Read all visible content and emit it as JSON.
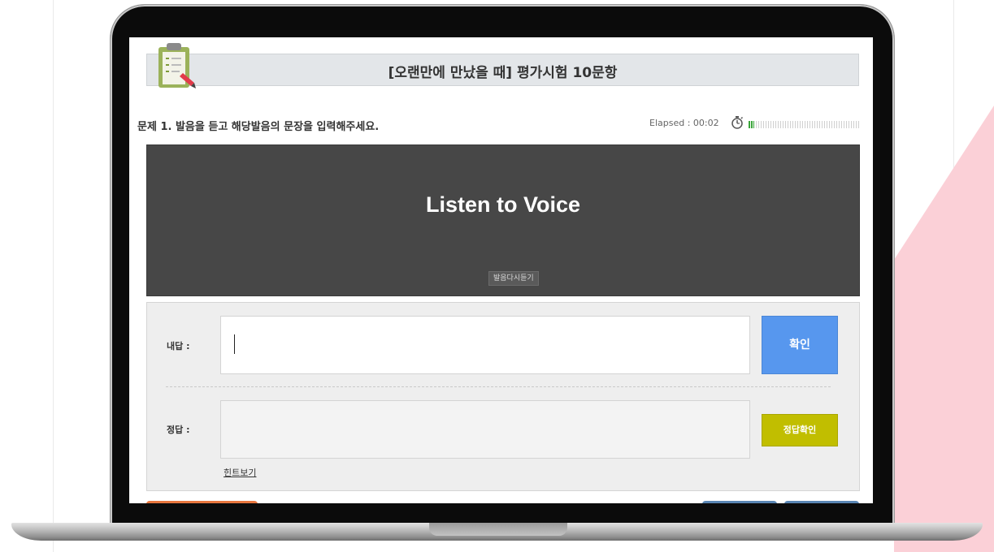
{
  "quiz": {
    "title": "[오랜만에 만났을 때] 평가시험 10문항",
    "icon": "clipboard-pencil-icon"
  },
  "question": {
    "text": "문제 1. 발음을 듣고 해당발음의 문장을 입력해주세요.",
    "elapsed_label": "Elapsed : 00:02",
    "timer_icon": "stopwatch-icon",
    "progress_fraction": 0.05
  },
  "player": {
    "title": "Listen to Voice",
    "replay_label": "발음다시듣기"
  },
  "answer": {
    "your_answer_label": "내답 :",
    "input_value": "",
    "confirm_label": "확인",
    "correct_answer_label": "정답 :",
    "correct_answer_value": "",
    "check_answer_label": "정답확인",
    "hint_label": "힌트보기"
  },
  "colors": {
    "confirm_button": "#5797ee",
    "check_button": "#c1be00",
    "progress": "#3aa53a",
    "player_bg": "#474747"
  }
}
